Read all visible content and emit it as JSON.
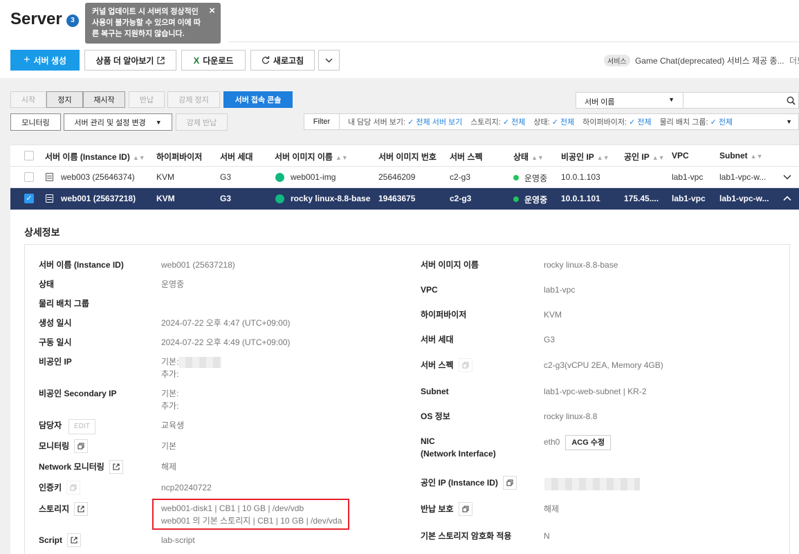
{
  "header": {
    "title": "Server",
    "badge": "3",
    "tooltip": "커널 업데이트 시 서버의 정상적인 사용이 불가능할 수 있으며 이에 따른 복구는 지원하지 않습니다.",
    "tooltip_close": "×",
    "toolbar": {
      "create": "서버 생성",
      "learn_more": "상품 더 알아보기",
      "download": "다운로드",
      "refresh": "새로고침"
    },
    "notice_tag": "서비스",
    "notice_text": "Game Chat(deprecated) 서비스 제공 종...",
    "notice_more": "더보기"
  },
  "actions": {
    "start": "시작",
    "stop": "정지",
    "restart": "재시작",
    "return": "반납",
    "force_stop": "강제 정지",
    "console": "서버 접속 콘솔",
    "monitoring": "모니터링",
    "manage": "서버 관리 및 설정 변경",
    "force_return": "강제 반납"
  },
  "search": {
    "field": "서버 이름",
    "value": ""
  },
  "filter": {
    "label": "Filter",
    "items": [
      {
        "label": "내 담당 서버 보기:",
        "value": "✓ 전체 서버 보기"
      },
      {
        "label": "스토리지:",
        "value": "✓ 전체"
      },
      {
        "label": "상태:",
        "value": "✓ 전체"
      },
      {
        "label": "하이퍼바이저:",
        "value": "✓ 전체"
      },
      {
        "label": "물리 배치 그룹:",
        "value": "✓ 전체"
      }
    ]
  },
  "table": {
    "columns": [
      "서버 이름 (Instance ID)",
      "하이퍼바이저",
      "서버 세대",
      "서버 이미지 이름",
      "서버 이미지 번호",
      "서버 스펙",
      "상태",
      "비공인 IP",
      "공인 IP",
      "VPC",
      "Subnet"
    ],
    "rows": [
      {
        "name": "web003 (25646374)",
        "hypervisor": "KVM",
        "generation": "G3",
        "image_name": "web001-img",
        "image_no": "25646209",
        "spec": "c2-g3",
        "status": "운영중",
        "private_ip": "10.0.1.103",
        "public_ip": "",
        "vpc": "lab1-vpc",
        "subnet": "lab1-vpc-w...",
        "selected": false
      },
      {
        "name": "web001 (25637218)",
        "hypervisor": "KVM",
        "generation": "G3",
        "image_name": "rocky linux-8.8-base",
        "image_no": "19463675",
        "spec": "c2-g3",
        "status": "운영중",
        "private_ip": "10.0.1.101",
        "public_ip": "175.45....",
        "vpc": "lab1-vpc",
        "subnet": "lab1-vpc-w...",
        "selected": true
      }
    ]
  },
  "detail": {
    "title": "상세정보",
    "left": {
      "name": {
        "label": "서버 이름 (Instance ID)",
        "value": "web001 (25637218)"
      },
      "status": {
        "label": "상태",
        "value": "운영중"
      },
      "placement": {
        "label": "물리 배치 그룹",
        "value": ""
      },
      "created": {
        "label": "생성 일시",
        "value": "2024-07-22 오후 4:47 (UTC+09:00)"
      },
      "started": {
        "label": "구동 일시",
        "value": "2024-07-22 오후 4:49 (UTC+09:00)"
      },
      "private_ip": {
        "label": "비공인 IP",
        "primary": "기본:",
        "secondary": "추가:"
      },
      "secondary_ip": {
        "label": "비공인 Secondary IP",
        "primary": "기본:",
        "secondary": "추가:"
      },
      "manager": {
        "label": "담당자",
        "edit": "EDIT",
        "value": "교육생"
      },
      "monitoring": {
        "label": "모니터링",
        "value": "기본"
      },
      "net_monitoring": {
        "label": "Network 모니터링",
        "value": "해제"
      },
      "auth_key": {
        "label": "인증키",
        "value": "ncp20240722"
      },
      "storage": {
        "label": "스토리지",
        "values": [
          "web001-disk1 | CB1 | 10 GB | /dev/vdb",
          "web001 의 기본 스토리지 | CB1 | 10 GB | /dev/vda"
        ]
      },
      "script": {
        "label": "Script",
        "value": "lab-script"
      }
    },
    "right": {
      "image_name": {
        "label": "서버 이미지 이름",
        "value": "rocky linux-8.8-base"
      },
      "vpc": {
        "label": "VPC",
        "value": "lab1-vpc"
      },
      "hypervisor": {
        "label": "하이퍼바이저",
        "value": "KVM"
      },
      "generation": {
        "label": "서버 세대",
        "value": "G3"
      },
      "spec": {
        "label": "서버 스펙",
        "value": "c2-g3(vCPU 2EA, Memory 4GB)"
      },
      "subnet": {
        "label": "Subnet",
        "value": "lab1-vpc-web-subnet | KR-2"
      },
      "os": {
        "label": "OS 정보",
        "value": "rocky linux-8.8"
      },
      "nic": {
        "label_1": "NIC",
        "label_2": "(Network Interface)",
        "value": "eth0",
        "acg_button": "ACG 수정"
      },
      "public_ip": {
        "label": "공인 IP (Instance ID)",
        "value": ""
      },
      "return_protect": {
        "label": "반납 보호",
        "value": "해제"
      },
      "encryption": {
        "label": "기본 스토리지 암호화 적용",
        "value": "N"
      }
    }
  },
  "colors": {
    "primary": "#1a9be8",
    "selected_row": "#283a66",
    "status_ok": "#21c45d",
    "highlight": "#e8212b"
  }
}
